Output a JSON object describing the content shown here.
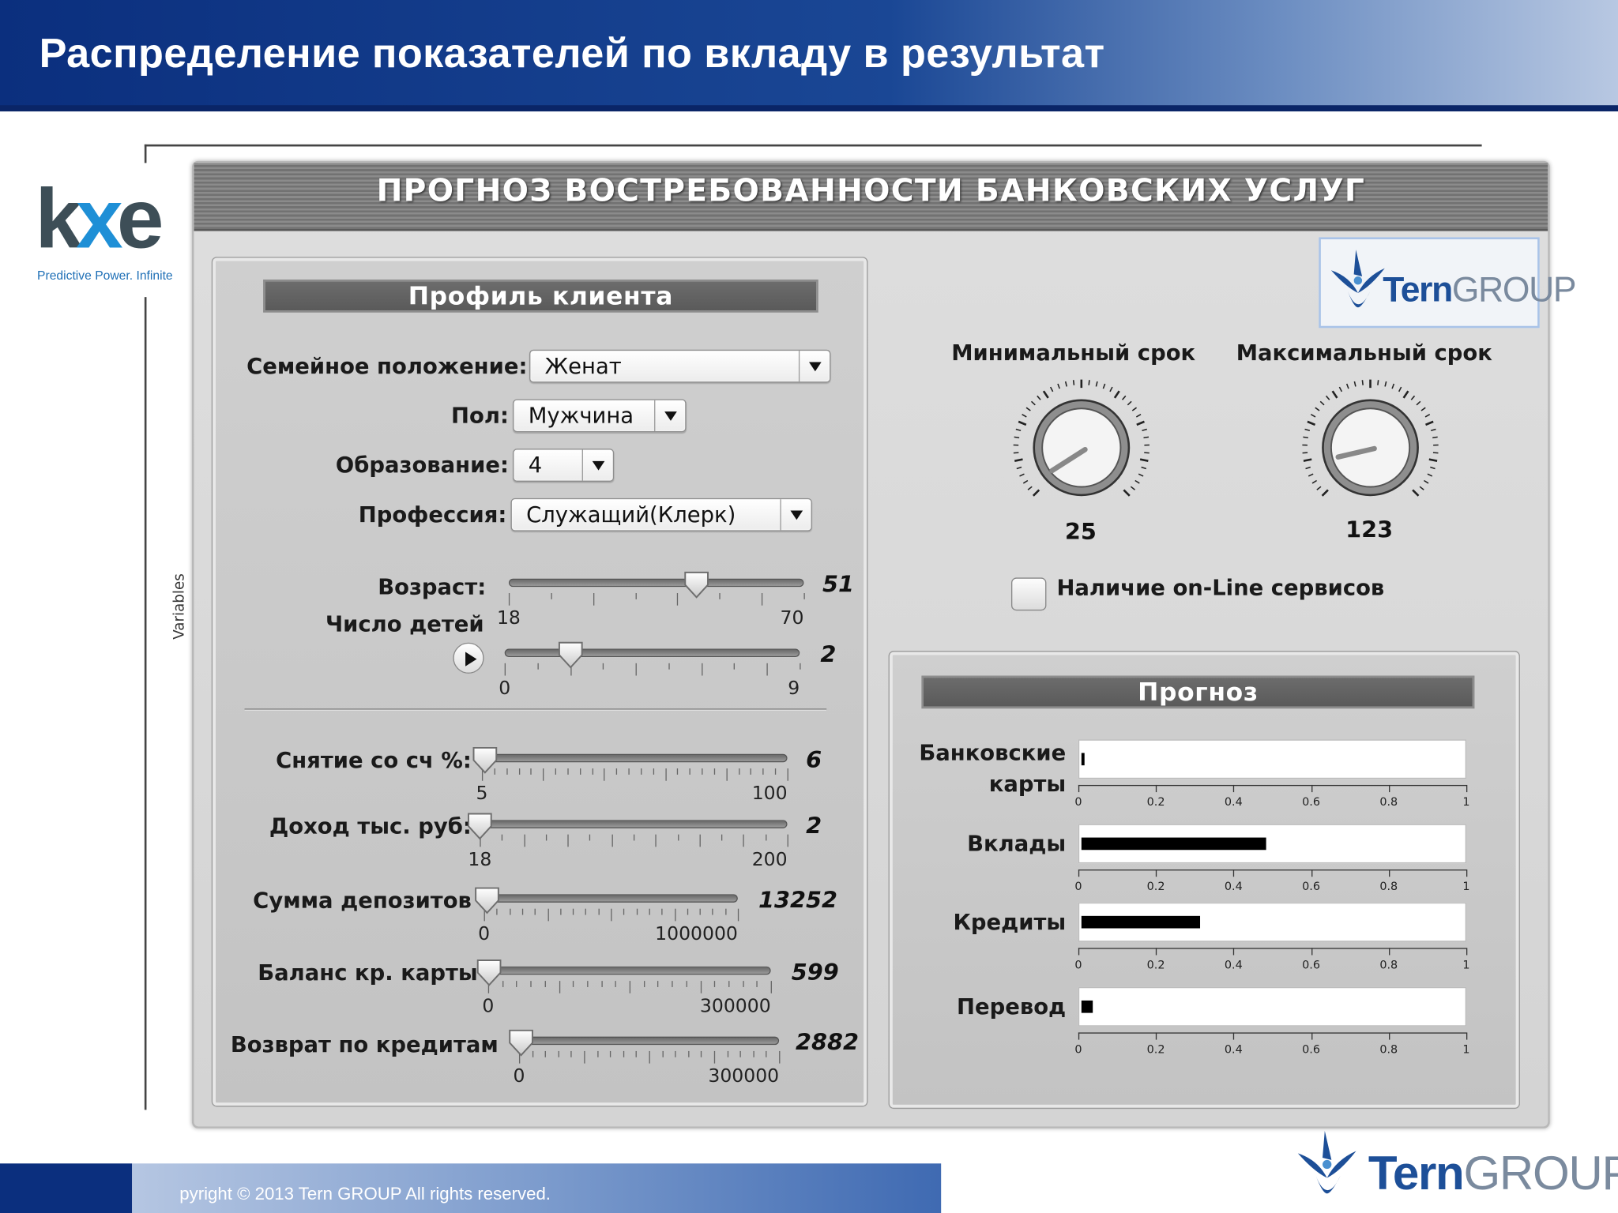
{
  "slide": {
    "title": "Распределение показателей по вкладу в результат",
    "copyright": "pyright © 2013 Tern GROUP All rights reserved."
  },
  "kxen": {
    "mark_k": "k",
    "mark_x": "x",
    "mark_e": "e",
    "tagline": "Predictive Power. Infinite"
  },
  "vertical_label": "Variables",
  "app": {
    "title": "ПРОГНОЗ ВОСТРЕБОВАННОСТИ БАНКОВСКИХ УСЛУГ",
    "profile": {
      "header": "Профиль клиента",
      "marital_label": "Семейное положение:",
      "marital_value": "Женат",
      "gender_label": "Пол:",
      "gender_value": "Мужчина",
      "education_label": "Образование:",
      "education_value": "4",
      "profession_label": "Профессия:",
      "profession_value": "Служащий(Клерк)",
      "age": {
        "label": "Возраст:",
        "value": "51",
        "min": "18",
        "max": "70",
        "level": 51,
        "lo": 18,
        "hi": 70
      },
      "children": {
        "label": "Число детей",
        "value": "2",
        "min": "0",
        "max": "9",
        "level": 2,
        "lo": 0,
        "hi": 9
      },
      "withdrawal": {
        "label": "Снятие  со сч %:",
        "value": "6",
        "min": "5",
        "max": "100",
        "level": 6,
        "lo": 5,
        "hi": 100
      },
      "income": {
        "label": "Доход тыс. руб:",
        "value": "2",
        "min": "18",
        "max": "200",
        "level": 18,
        "lo": 18,
        "hi": 200
      },
      "deposits": {
        "label": "Сумма депозитов",
        "value": "13252",
        "min": "0",
        "max": "1000000",
        "level": 13252,
        "lo": 0,
        "hi": 1000000
      },
      "card_balance": {
        "label": "Баланс кр. карты",
        "value": "599",
        "min": "0",
        "max": "300000",
        "level": 599,
        "lo": 0,
        "hi": 300000
      },
      "loan_return": {
        "label": "Возврат по кредитам",
        "value": "2882",
        "min": "0",
        "max": "300000",
        "level": 2882,
        "lo": 0,
        "hi": 300000
      }
    },
    "terms": {
      "min_label": "Минимальный срок",
      "min_value": "25",
      "max_label": "Максимальный срок",
      "max_value": "123",
      "online_label": "Наличие on-Line сервисов"
    },
    "tern": {
      "word1": "Tern",
      "word2": "GROUP"
    },
    "forecast": {
      "header": "Прогноз",
      "axis_ticks": [
        "0",
        "0.2",
        "0.4",
        "0.6",
        "0.8",
        "1"
      ],
      "bars": [
        {
          "label": "Банковские карты",
          "value": 0.005
        },
        {
          "label": "Вклады",
          "value": 0.48
        },
        {
          "label": "Кредиты",
          "value": 0.31
        },
        {
          "label": "Перевод",
          "value": 0.03
        }
      ]
    }
  },
  "footer_logo": {
    "word1": "Tern",
    "word2": "GROUP"
  },
  "colors": {
    "header_blue": "#0b2f7e",
    "tern_blue": "#1d4f98",
    "panel_gray": "#d4d4d4"
  }
}
